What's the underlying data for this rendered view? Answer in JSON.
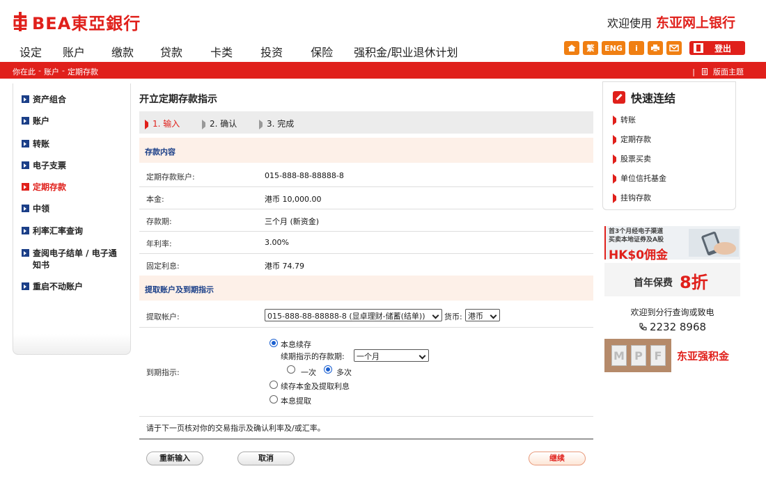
{
  "header": {
    "logo_text": "BEA東亞銀行",
    "welcome_text": "欢迎使用",
    "welcome_brand": "东亚网上银行",
    "nav": [
      "设定",
      "账户",
      "缴款",
      "贷款",
      "卡类",
      "投资",
      "保险",
      "强积金/职业退休计划"
    ],
    "icons": [
      {
        "name": "home-icon",
        "label": ""
      },
      {
        "name": "traditional-chinese-icon",
        "label": "繁"
      },
      {
        "name": "english-icon",
        "label": "ENG"
      },
      {
        "name": "info-icon",
        "label": "i"
      },
      {
        "name": "print-icon",
        "label": ""
      },
      {
        "name": "mail-icon",
        "label": ""
      }
    ],
    "logout_label": "登出",
    "brand_color": "#e0201b"
  },
  "breadcrumb": {
    "items": [
      "你在此",
      "账户",
      "定期存款"
    ],
    "theme_label": "版面主题"
  },
  "sidebar": {
    "items": [
      {
        "label": "资产组合",
        "active": false
      },
      {
        "label": "账户",
        "active": false
      },
      {
        "label": "转账",
        "active": false
      },
      {
        "label": "电子支票",
        "active": false
      },
      {
        "label": "定期存款",
        "active": true
      },
      {
        "label": "中领",
        "active": false
      },
      {
        "label": "利率汇率查询",
        "active": false
      },
      {
        "label": "查阅电子结单 / 电子通",
        "label2": "知书",
        "active": false
      },
      {
        "label": "重启不动账户",
        "active": false
      }
    ]
  },
  "main": {
    "title": "开立定期存款指示",
    "steps": [
      "1. 输入",
      "2. 确认",
      "3. 完成"
    ],
    "deposit_section": "存款内容",
    "deposit_rows": [
      {
        "label": "定期存款账户:",
        "value": "015-888-88-88888-8"
      },
      {
        "label": "本金:",
        "value": "港币 10,000.00"
      },
      {
        "label": "存款期:",
        "value": "三个月 (新资金)"
      },
      {
        "label": "年利率:",
        "value": "3.00%"
      },
      {
        "label": "固定利息:",
        "value": "港币 74.79"
      }
    ],
    "withdraw_section": "提取账户及到期指示",
    "withdraw_label": "提取帐户:",
    "withdraw_account": "015-888-88-88888-8 (显卓理财-储蓄(结单))",
    "currency_label": "货币:",
    "currency_value": "港币",
    "maturity_label": "到期指示:",
    "options": {
      "opt1": "本息续存",
      "renew_period_label": "续期指示的存款期:",
      "renew_period_value": "一个月",
      "once": "一次",
      "multiple": "多次",
      "opt2": "续存本金及提取利息",
      "opt3": "本息提取"
    },
    "note": "请于下一页核对你的交易指示及确认利率及/或汇率。",
    "buttons": {
      "reset": "重新输入",
      "cancel": "取消",
      "continue": "继续"
    }
  },
  "quick_links": {
    "title": "快速连结",
    "items": [
      "转账",
      "定期存款",
      "股票买卖",
      "单位信托基金",
      "挂钩存款"
    ]
  },
  "promos": {
    "banner1_line1": "首3个月经电子渠道",
    "banner1_line2": "买卖本地证券及A股",
    "banner1_big": "HK$0佣金",
    "banner2_text": "首年保费",
    "banner2_big": "8折",
    "contact_text": "欢迎到分行查询或致电",
    "contact_phone": "2232 8968",
    "mpf_letters": [
      "M",
      "P",
      "F"
    ],
    "mpf_text": "东亚强积金"
  }
}
